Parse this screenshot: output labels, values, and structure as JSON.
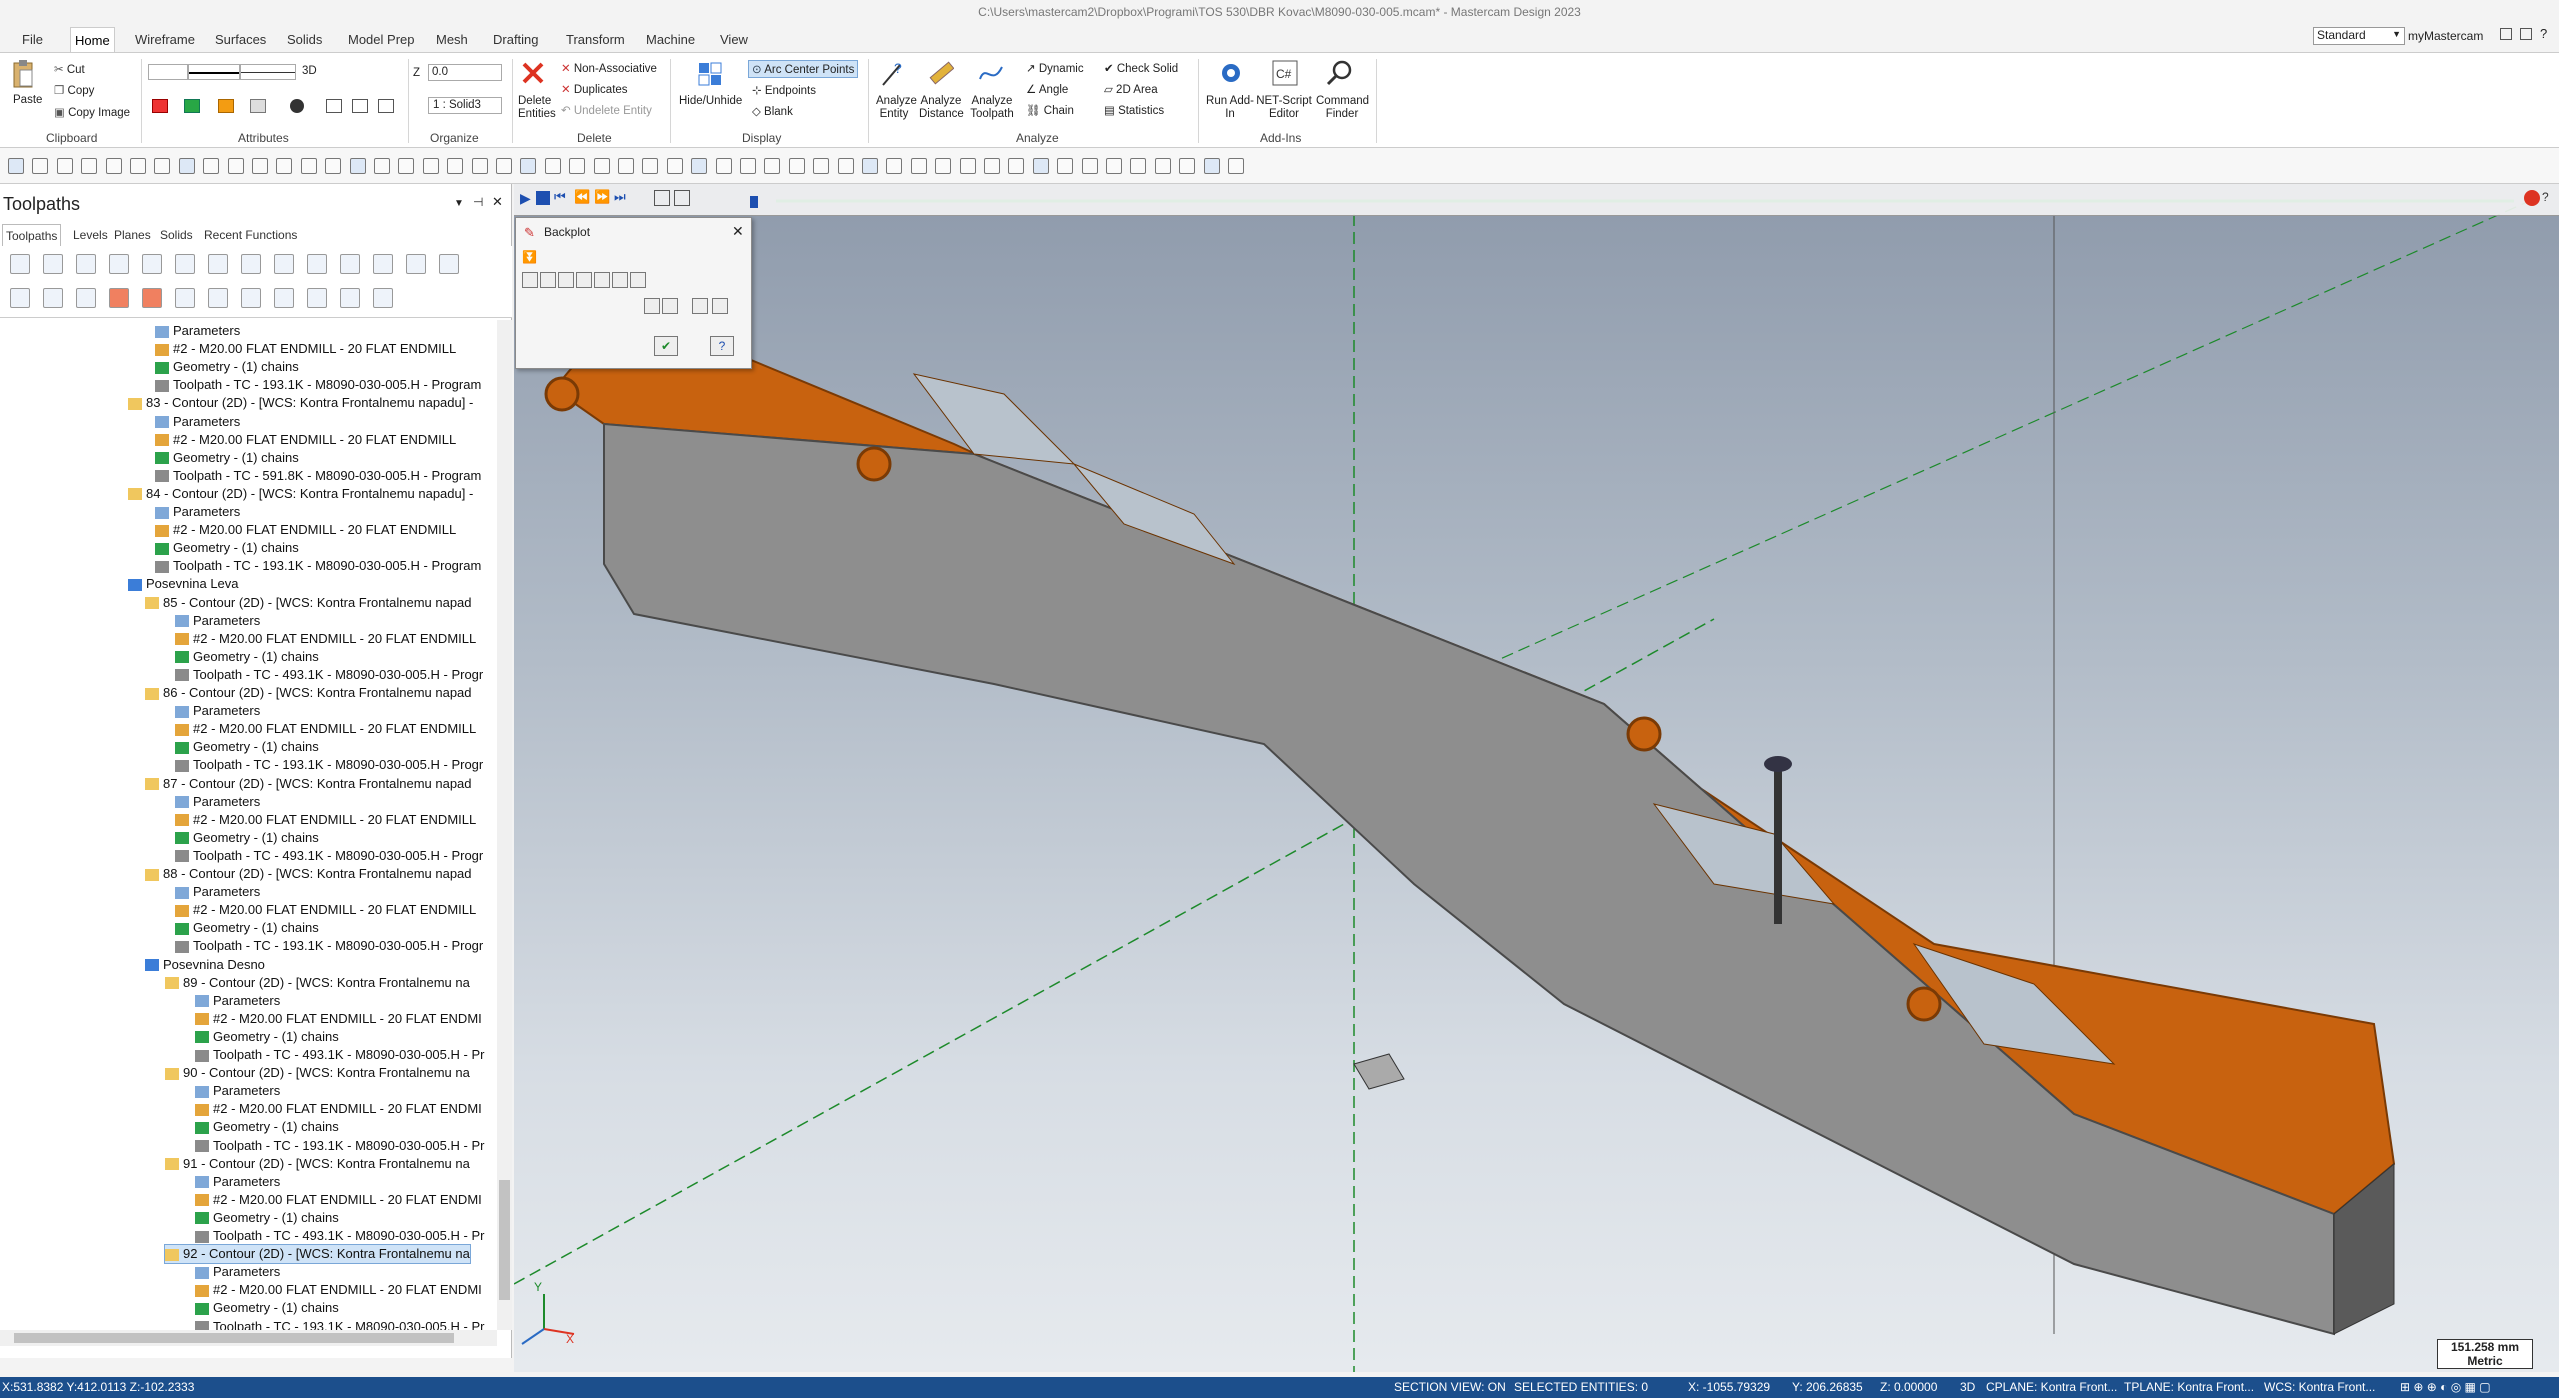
{
  "window": {
    "title": "C:\\Users\\mastercam2\\Dropbox\\Programi\\TOS 530\\DBR Kovac\\M8090-030-005.mcam* - Mastercam Design 2023"
  },
  "menu_tabs": [
    "File",
    "Home",
    "Wireframe",
    "Surfaces",
    "Solids",
    "Model Prep",
    "Mesh",
    "Drafting",
    "Transform",
    "Machine",
    "View"
  ],
  "ribbon_right": {
    "profile": "Standard",
    "account": "myMastercam"
  },
  "clipboard": {
    "paste": "Paste",
    "cut": "Cut",
    "copy": "Copy",
    "copy_image": "Copy Image",
    "label": "Clipboard"
  },
  "attributes": {
    "mode": "3D",
    "label": "Attributes"
  },
  "organize": {
    "z_label": "Z",
    "z_value": "0.0",
    "level": "1 : Solid3",
    "label": "Organize"
  },
  "delete": {
    "delete_entities": "Delete Entities",
    "non_associative": "Non-Associative",
    "duplicates": "Duplicates",
    "undelete": "Undelete Entity",
    "label": "Delete"
  },
  "display": {
    "hide_unhide": "Hide/Unhide",
    "arc_center": "Arc Center Points",
    "endpoints": "Endpoints",
    "blank": "Blank",
    "label": "Display"
  },
  "analyze": {
    "entity": "Analyze Entity",
    "distance": "Analyze Distance",
    "toolpath": "Analyze Toolpath",
    "dynamic": "Dynamic",
    "angle": "Angle",
    "chain": "Chain",
    "check_solid": "Check Solid",
    "area2d": "2D Area",
    "statistics": "Statistics",
    "label": "Analyze"
  },
  "addins": {
    "run": "Run Add-In",
    "net": "NET-Script Editor",
    "command": "Command Finder",
    "label": "Add-Ins"
  },
  "panel": {
    "title": "Toolpaths",
    "tabs": [
      "Toolpaths",
      "Levels",
      "Planes",
      "Solids",
      "Recent Functions"
    ]
  },
  "tree": [
    {
      "d": 0,
      "icon": "param",
      "text": "Parameters"
    },
    {
      "d": 0,
      "icon": "tool",
      "text": "#2 - M20.00 FLAT ENDMILL - 20 FLAT ENDMILL"
    },
    {
      "d": 0,
      "icon": "geom",
      "text": "Geometry - (1) chains"
    },
    {
      "d": 0,
      "icon": "path",
      "text": "Toolpath - TC - 193.1K - M8090-030-005.H - Program"
    },
    {
      "d": -1,
      "icon": "folder",
      "text": "83 - Contour (2D) - [WCS: Kontra Frontalnemu napadu] -"
    },
    {
      "d": 0,
      "icon": "param",
      "text": "Parameters"
    },
    {
      "d": 0,
      "icon": "tool",
      "text": "#2 - M20.00 FLAT ENDMILL - 20 FLAT ENDMILL"
    },
    {
      "d": 0,
      "icon": "geom",
      "text": "Geometry - (1) chains"
    },
    {
      "d": 0,
      "icon": "path",
      "text": "Toolpath - TC - 591.8K - M8090-030-005.H - Program"
    },
    {
      "d": -1,
      "icon": "folder",
      "text": "84 - Contour (2D) - [WCS: Kontra Frontalnemu napadu] -"
    },
    {
      "d": 0,
      "icon": "param",
      "text": "Parameters"
    },
    {
      "d": 0,
      "icon": "tool",
      "text": "#2 - M20.00 FLAT ENDMILL - 20 FLAT ENDMILL"
    },
    {
      "d": 0,
      "icon": "geom",
      "text": "Geometry - (1) chains"
    },
    {
      "d": 0,
      "icon": "path",
      "text": "Toolpath - TC - 193.1K - M8090-030-005.H - Program"
    },
    {
      "d": -2,
      "icon": "group",
      "text": "Posevnina Leva"
    },
    {
      "d": -1,
      "icon": "folder",
      "text": "85 - Contour (2D) - [WCS: Kontra Frontalnemu napad"
    },
    {
      "d": 0,
      "icon": "param",
      "text": "Parameters"
    },
    {
      "d": 0,
      "icon": "tool",
      "text": "#2 - M20.00 FLAT ENDMILL - 20 FLAT ENDMILL"
    },
    {
      "d": 0,
      "icon": "geom",
      "text": "Geometry - (1) chains"
    },
    {
      "d": 0,
      "icon": "path",
      "text": "Toolpath - TC - 493.1K - M8090-030-005.H - Progr"
    },
    {
      "d": -1,
      "icon": "folder",
      "text": "86 - Contour (2D) - [WCS: Kontra Frontalnemu napad"
    },
    {
      "d": 0,
      "icon": "param",
      "text": "Parameters"
    },
    {
      "d": 0,
      "icon": "tool",
      "text": "#2 - M20.00 FLAT ENDMILL - 20 FLAT ENDMILL"
    },
    {
      "d": 0,
      "icon": "geom",
      "text": "Geometry - (1) chains"
    },
    {
      "d": 0,
      "icon": "path",
      "text": "Toolpath - TC - 193.1K - M8090-030-005.H - Progr"
    },
    {
      "d": -1,
      "icon": "folder",
      "text": "87 - Contour (2D) - [WCS: Kontra Frontalnemu napad"
    },
    {
      "d": 0,
      "icon": "param",
      "text": "Parameters"
    },
    {
      "d": 0,
      "icon": "tool",
      "text": "#2 - M20.00 FLAT ENDMILL - 20 FLAT ENDMILL"
    },
    {
      "d": 0,
      "icon": "geom",
      "text": "Geometry - (1) chains"
    },
    {
      "d": 0,
      "icon": "path",
      "text": "Toolpath - TC - 493.1K - M8090-030-005.H - Progr"
    },
    {
      "d": -1,
      "icon": "folder",
      "text": "88 - Contour (2D) - [WCS: Kontra Frontalnemu napad"
    },
    {
      "d": 0,
      "icon": "param",
      "text": "Parameters"
    },
    {
      "d": 0,
      "icon": "tool",
      "text": "#2 - M20.00 FLAT ENDMILL - 20 FLAT ENDMILL"
    },
    {
      "d": 0,
      "icon": "geom",
      "text": "Geometry - (1) chains"
    },
    {
      "d": 0,
      "icon": "path",
      "text": "Toolpath - TC - 193.1K - M8090-030-005.H - Progr"
    },
    {
      "d": -2,
      "icon": "group",
      "text": "Posevnina Desno"
    },
    {
      "d": -1,
      "icon": "folder",
      "text": "89 - Contour (2D) - [WCS: Kontra Frontalnemu na"
    },
    {
      "d": 0,
      "icon": "param",
      "text": "Parameters"
    },
    {
      "d": 0,
      "icon": "tool",
      "text": "#2 - M20.00 FLAT ENDMILL - 20 FLAT ENDMI"
    },
    {
      "d": 0,
      "icon": "geom",
      "text": "Geometry - (1) chains"
    },
    {
      "d": 0,
      "icon": "path",
      "text": "Toolpath - TC - 493.1K - M8090-030-005.H - Pr"
    },
    {
      "d": -1,
      "icon": "folder",
      "text": "90 - Contour (2D) - [WCS: Kontra Frontalnemu na"
    },
    {
      "d": 0,
      "icon": "param",
      "text": "Parameters"
    },
    {
      "d": 0,
      "icon": "tool",
      "text": "#2 - M20.00 FLAT ENDMILL - 20 FLAT ENDMI"
    },
    {
      "d": 0,
      "icon": "geom",
      "text": "Geometry - (1) chains"
    },
    {
      "d": 0,
      "icon": "path",
      "text": "Toolpath - TC - 193.1K - M8090-030-005.H - Pr"
    },
    {
      "d": -1,
      "icon": "folder",
      "text": "91 - Contour (2D) - [WCS: Kontra Frontalnemu na"
    },
    {
      "d": 0,
      "icon": "param",
      "text": "Parameters"
    },
    {
      "d": 0,
      "icon": "tool",
      "text": "#2 - M20.00 FLAT ENDMILL - 20 FLAT ENDMI"
    },
    {
      "d": 0,
      "icon": "geom",
      "text": "Geometry - (1) chains"
    },
    {
      "d": 0,
      "icon": "path",
      "text": "Toolpath - TC - 493.1K - M8090-030-005.H - Pr"
    },
    {
      "d": -1,
      "icon": "folder",
      "text": "92 - Contour (2D) - [WCS: Kontra Frontalnemu na",
      "selected": true
    },
    {
      "d": 0,
      "icon": "param",
      "text": "Parameters"
    },
    {
      "d": 0,
      "icon": "tool",
      "text": "#2 - M20.00 FLAT ENDMILL - 20 FLAT ENDMI"
    },
    {
      "d": 0,
      "icon": "geom",
      "text": "Geometry - (1) chains"
    },
    {
      "d": 0,
      "icon": "path",
      "text": "Toolpath - TC - 193.1K - M8090-030-005.H - Pr"
    }
  ],
  "backplot": {
    "title": "Backplot"
  },
  "viewport": {
    "scale_value": "151.258 mm",
    "scale_unit": "Metric",
    "axis_x": "X",
    "axis_y": "Y"
  },
  "status": {
    "coords": "X:531.8382  Y:412.0113  Z:-102.2333",
    "section_view": "SECTION VIEW: ON",
    "selected": "SELECTED ENTITIES: 0",
    "x": "X:   -1055.79329",
    "y": "Y:   206.26835",
    "z": "Z:   0.00000",
    "mode": "3D",
    "cplane": "CPLANE: Kontra Front...",
    "tplane": "TPLANE: Kontra Front...",
    "wcs": "WCS: Kontra Front..."
  },
  "colors": {
    "status_bg": "#1c4f8c",
    "part_orange": "#c8620f",
    "part_grey": "#8e8e8e",
    "selection": "#cfe3f7",
    "progress": "#22a84a"
  }
}
